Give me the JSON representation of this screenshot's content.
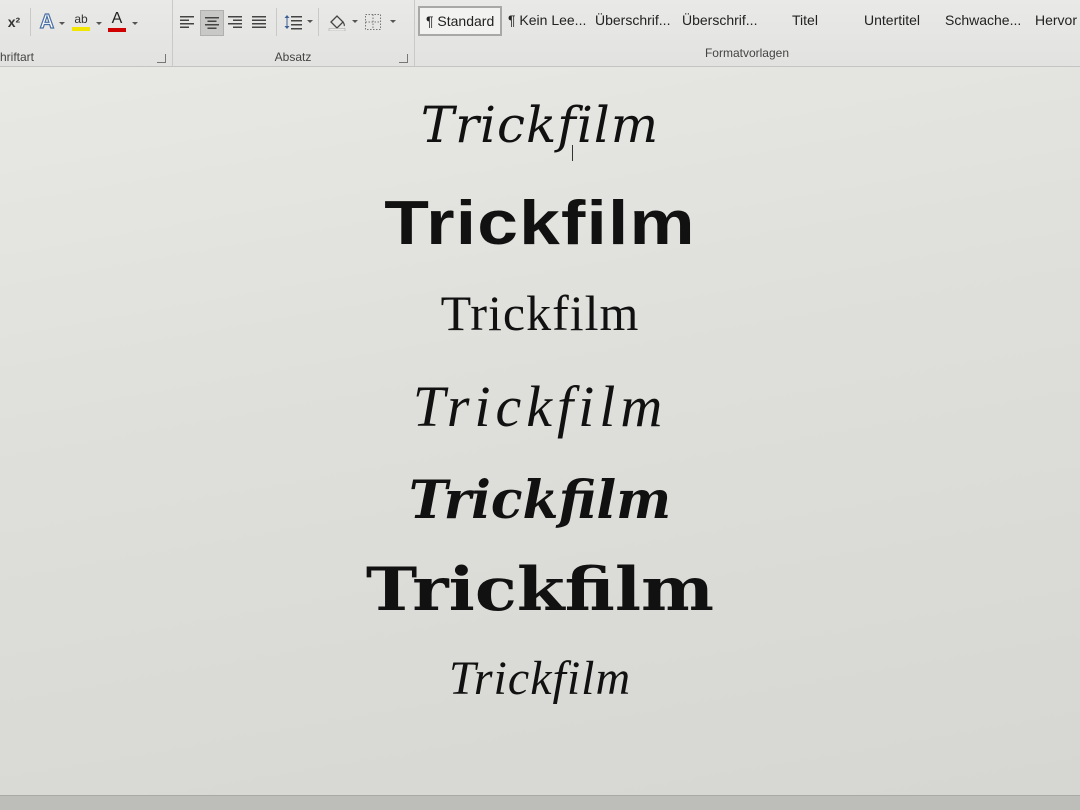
{
  "ribbon": {
    "font_group": {
      "label": "hriftart",
      "superscript_label": "x²",
      "text_effects_label": "A",
      "highlight_label": "ab",
      "font_color_label": "A",
      "highlight_color": "#f2e600",
      "font_color": "#d00000"
    },
    "paragraph_group": {
      "label": "Absatz"
    },
    "styles_group": {
      "label": "Formatvorlagen",
      "items": [
        {
          "label": "¶ Standard"
        },
        {
          "label": "¶ Kein Lee..."
        },
        {
          "label": "Überschrif..."
        },
        {
          "label": "Überschrif..."
        },
        {
          "label": "Titel"
        },
        {
          "label": "Untertitel"
        },
        {
          "label": "Schwache..."
        },
        {
          "label": "Hervor"
        }
      ]
    }
  },
  "document": {
    "lines": [
      "Trickfilm",
      "Trickfilm",
      "Trickfilm",
      "Trickfilm",
      "Trickfilm",
      "Trickfilm",
      "Trickfilm"
    ]
  }
}
